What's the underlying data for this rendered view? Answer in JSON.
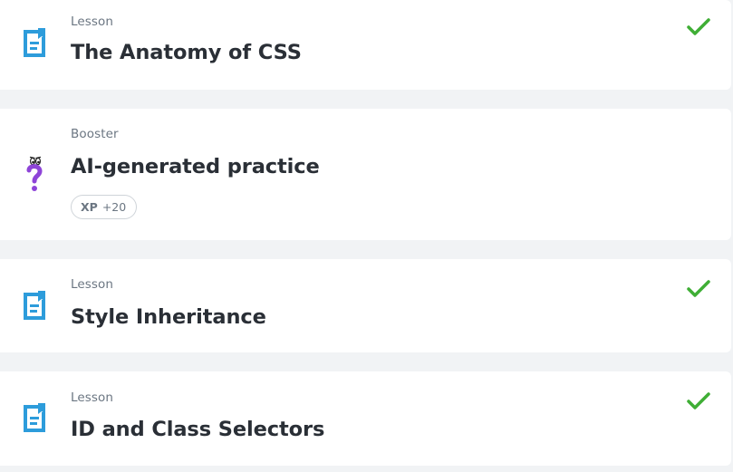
{
  "items": [
    {
      "type_label": "Lesson",
      "title": "The Anatomy of CSS",
      "icon": "lesson-document-icon",
      "completed": true
    },
    {
      "type_label": "Booster",
      "title": "AI-generated practice",
      "icon": "question-mark-icon",
      "completed": false,
      "xp": {
        "label": "XP",
        "value": "+20"
      }
    },
    {
      "type_label": "Lesson",
      "title": "Style Inheritance",
      "icon": "lesson-document-icon",
      "completed": true
    },
    {
      "type_label": "Lesson",
      "title": "ID and Class Selectors",
      "icon": "lesson-document-icon",
      "completed": true
    }
  ],
  "colors": {
    "lesson_icon": "#2d9cdb",
    "booster_icon": "#8e44d8",
    "check": "#3fae35",
    "background": "#f1f3f5"
  }
}
